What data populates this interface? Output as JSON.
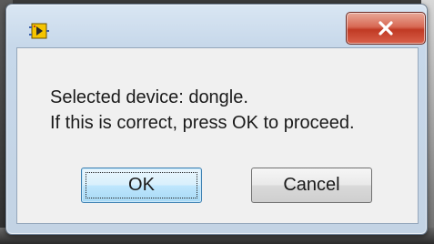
{
  "window": {
    "icon": "labview-app-icon",
    "close_glyph": "close-icon"
  },
  "message": {
    "line1": "Selected device: dongle.",
    "line2": "If this is correct,  press OK to proceed."
  },
  "buttons": {
    "ok_label": "OK",
    "cancel_label": "Cancel"
  },
  "colors": {
    "close_button": "#c03a24",
    "default_button_border": "#3c7fb1",
    "client_background": "#f0f0f0"
  }
}
